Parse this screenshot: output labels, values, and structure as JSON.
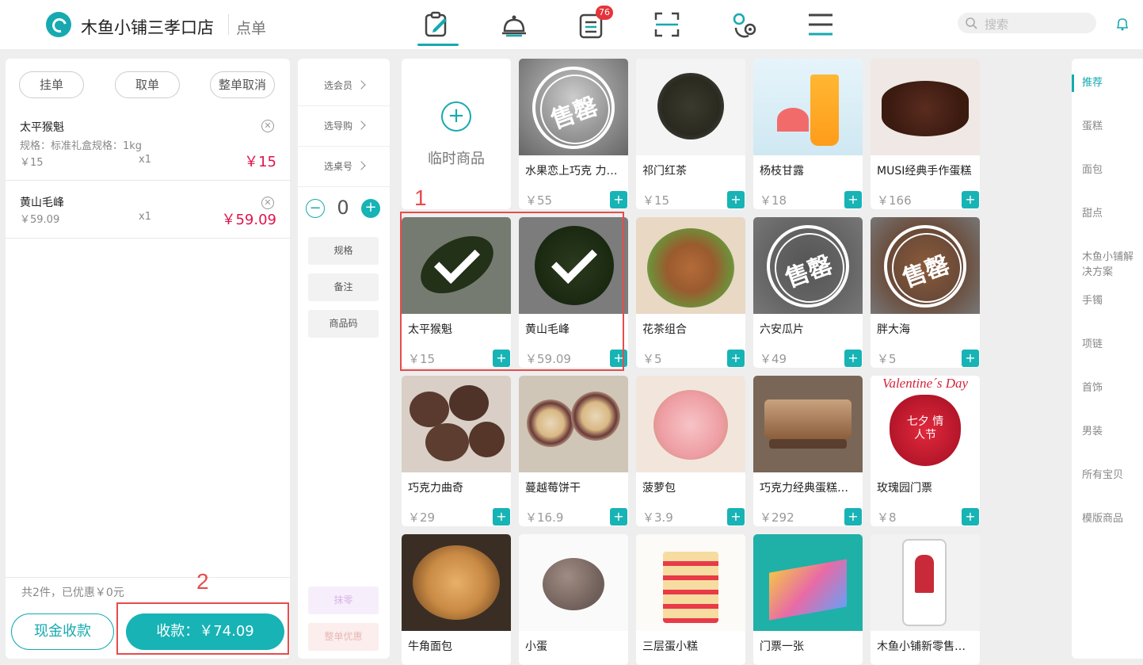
{
  "header": {
    "store_name": "木鱼小铺三孝口店",
    "mode": "点单",
    "badge_count": "76",
    "search_placeholder": "搜索",
    "nav_icons": [
      "order-edit-icon",
      "service-bell-icon",
      "orders-list-icon",
      "scan-icon",
      "settings-icon",
      "menu-icon"
    ]
  },
  "cart": {
    "buttons": [
      "挂单",
      "取单",
      "整单取消"
    ],
    "items": [
      {
        "name": "太平猴魁",
        "spec": "规格：标准礼盒规格：1kg",
        "unit_price": "￥15",
        "qty": "x1",
        "total": "￥15"
      },
      {
        "name": "黄山毛峰",
        "spec": "",
        "unit_price": "￥59.09",
        "qty": "x1",
        "total": "￥59.09"
      }
    ],
    "summary": "共2件，已优惠￥0元",
    "cash_button": "现金收款",
    "pay_button": "收款：￥74.09"
  },
  "options": {
    "select_member": "选会员",
    "select_guide": "选导购",
    "select_table": "选桌号",
    "quantity": "0",
    "spec": "规格",
    "note": "备注",
    "product_code": "商品码",
    "round_off": "抹零",
    "order_discount": "整单优惠"
  },
  "products": {
    "temp_label": "临时商品",
    "sold_out_label": "售罄",
    "items": [
      {
        "name": "水果恋上巧克 力…",
        "price": "￥55"
      },
      {
        "name": "祁门红茶",
        "price": "￥15"
      },
      {
        "name": "杨枝甘露",
        "price": "￥18"
      },
      {
        "name": "MUSI经典手作蛋糕",
        "price": "￥166"
      },
      {
        "name": "太平猴魁",
        "price": "￥15"
      },
      {
        "name": "黄山毛峰",
        "price": "￥59.09"
      },
      {
        "name": "花茶组合",
        "price": "￥5"
      },
      {
        "name": "六安瓜片",
        "price": "￥49"
      },
      {
        "name": "胖大海",
        "price": "￥5"
      },
      {
        "name": "巧克力曲奇",
        "price": "￥29"
      },
      {
        "name": "蔓越莓饼干",
        "price": "￥16.9"
      },
      {
        "name": "菠萝包",
        "price": "￥3.9"
      },
      {
        "name": "巧克力经典蛋糕…",
        "price": "￥292"
      },
      {
        "name": "玫瑰园门票",
        "price": "￥8"
      },
      {
        "name": "牛角面包",
        "price": ""
      },
      {
        "name": "小蛋",
        "price": ""
      },
      {
        "name": "三层蛋小糕",
        "price": ""
      },
      {
        "name": "门票一张",
        "price": ""
      },
      {
        "name": "木鱼小铺新零售…",
        "price": ""
      }
    ],
    "valentine_text": "Valentine´s Day",
    "qixi_text": "七夕 情人节"
  },
  "categories": [
    "推荐",
    "蛋糕",
    "面包",
    "甜点",
    "木鱼小铺解决方案",
    "手镯",
    "项链",
    "首饰",
    "男装",
    "所有宝贝",
    "模版商品"
  ],
  "annotations": [
    "1",
    "2"
  ],
  "colors": {
    "accent": "#17b3b5",
    "price_red": "#e0134c",
    "annotation_red": "#e74c4c",
    "badge_red": "#e5353a"
  }
}
